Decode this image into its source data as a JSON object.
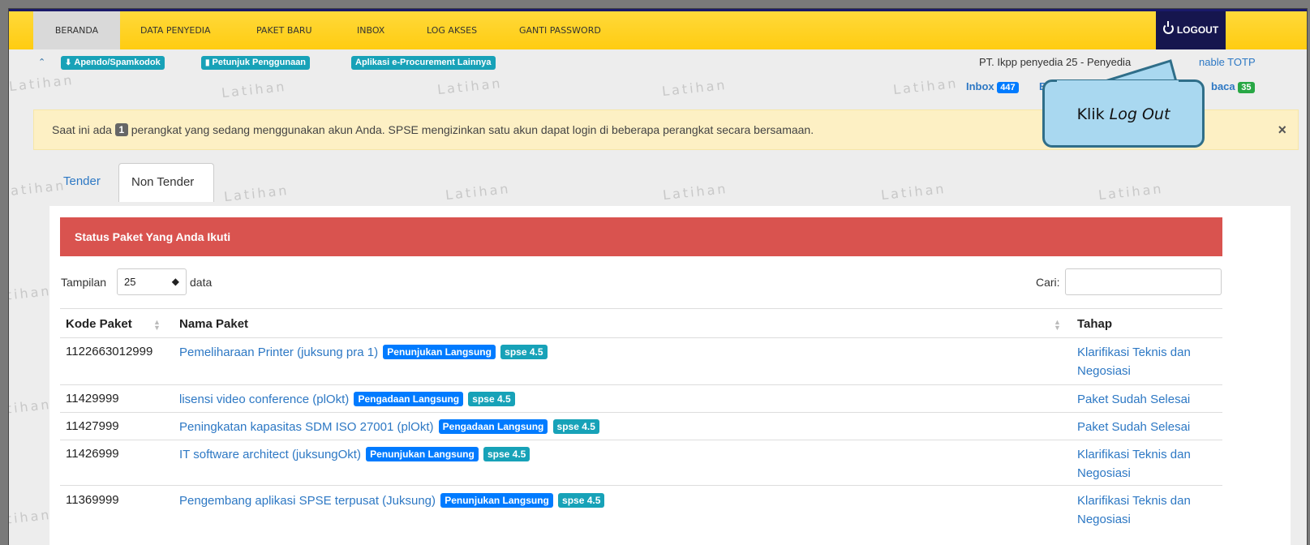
{
  "nav": {
    "items": [
      "BERANDA",
      "DATA PENYEDIA",
      "PAKET BARU",
      "INBOX",
      "LOG AKSES",
      "GANTI PASSWORD"
    ],
    "logout": "LOGOUT"
  },
  "subbar": {
    "buttons": [
      "Apendo/Spamkodok",
      "Petunjuk Penggunaan",
      "Aplikasi e-Procurement Lainnya"
    ],
    "company": "PT. Ikpp penyedia 25 - Penyedia",
    "link_partial": "nable TOTP",
    "inbox_label": "Inbox",
    "inbox_count": "447",
    "partial_left": "B",
    "partial_right": "baca",
    "partial_right_count": "35"
  },
  "watermark": "Latihan",
  "alert": {
    "prefix": "Saat ini ada",
    "count": "1",
    "suffix": "perangkat yang sedang menggunakan akun Anda. SPSE mengizinkan satu akun dapat login di beberapa perangkat secara bersamaan.",
    "close": "×"
  },
  "callout": {
    "prefix": "Klik",
    "italic": "Log Out"
  },
  "tabs": [
    "Tender",
    "Non Tender"
  ],
  "panel": {
    "title": "Status Paket Yang Anda Ikuti",
    "show_label": "Tampilan",
    "show_value": "25",
    "show_suffix": "data",
    "search_label": "Cari:"
  },
  "table": {
    "headers": [
      "Kode Paket",
      "Nama Paket",
      "Tahap"
    ],
    "rows": [
      {
        "code": "1122663012999",
        "name": "Pemeliharaan Printer (juksung pra 1)",
        "method": "Penunjukan Langsung",
        "version": "spse 4.5",
        "stage": "Klarifikasi Teknis dan Negosiasi"
      },
      {
        "code": "11429999",
        "name": "lisensi video conference (plOkt)",
        "method": "Pengadaan Langsung",
        "version": "spse 4.5",
        "stage": "Paket Sudah Selesai"
      },
      {
        "code": "11427999",
        "name": "Peningkatan kapasitas SDM ISO 27001 (plOkt)",
        "method": "Pengadaan Langsung",
        "version": "spse 4.5",
        "stage": "Paket Sudah Selesai"
      },
      {
        "code": "11426999",
        "name": "IT software architect (juksungOkt)",
        "method": "Penunjukan Langsung",
        "version": "spse 4.5",
        "stage": "Klarifikasi Teknis dan Negosiasi"
      },
      {
        "code": "11369999",
        "name": "Pengembang aplikasi SPSE terpusat (Juksung)",
        "method": "Penunjukan Langsung",
        "version": "spse 4.5",
        "stage": "Klarifikasi Teknis dan Negosiasi"
      }
    ]
  }
}
